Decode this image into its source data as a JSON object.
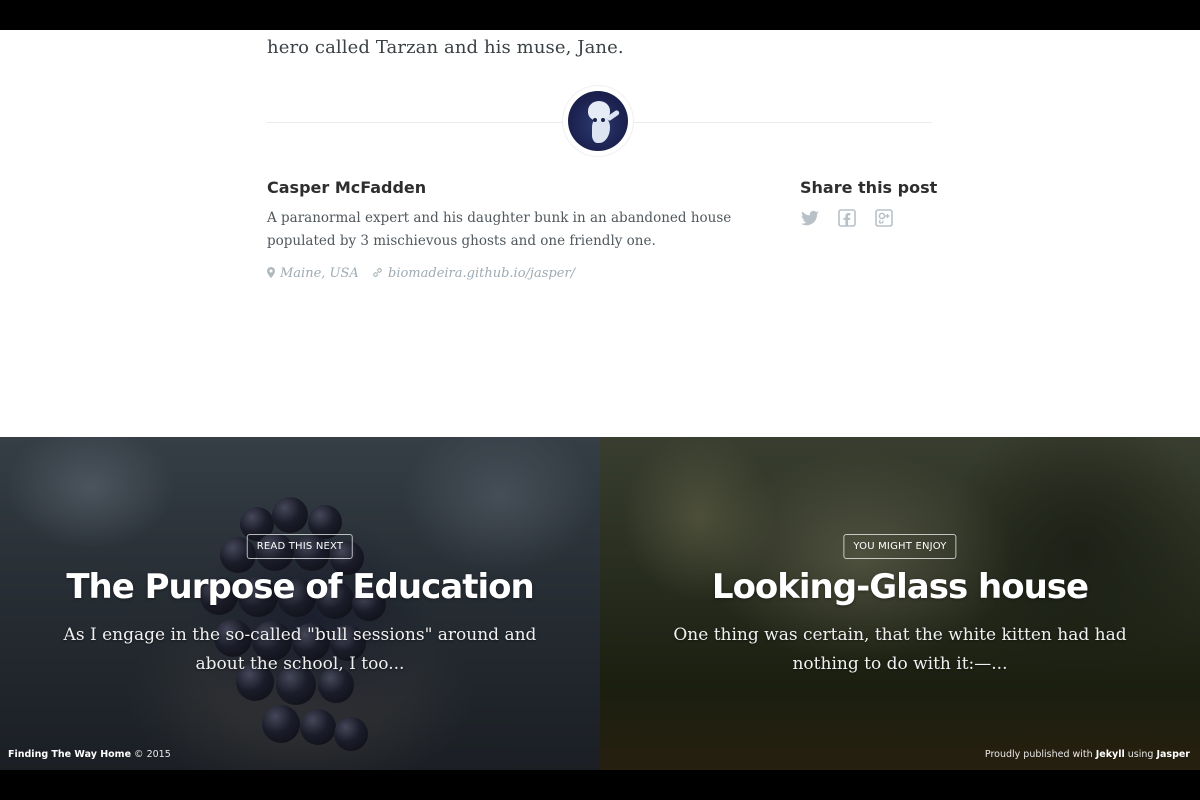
{
  "article": {
    "closing_text": "hero called Tarzan and his muse, Jane."
  },
  "author": {
    "avatar_icon": "ghost-avatar",
    "name": "Casper McFadden",
    "bio": "A paranormal expert and his daughter bunk in an abandoned house populated by 3 mischievous ghosts and one friendly one.",
    "location": "Maine, USA",
    "website": "biomadeira.github.io/jasper/",
    "location_icon": "map-pin-icon",
    "website_icon": "link-icon"
  },
  "share": {
    "title": "Share this post",
    "icons": [
      "twitter-icon",
      "facebook-icon",
      "google-plus-icon"
    ]
  },
  "next_posts": [
    {
      "tag": "READ THIS NEXT",
      "title": "The Purpose of Education",
      "excerpt": "As I engage in the so-called \"bull sessions\" around and about the school, I too..."
    },
    {
      "tag": "YOU MIGHT ENJOY",
      "title": "Looking-Glass house",
      "excerpt": "One thing was certain, that the white kitten had had nothing to do with it:—..."
    }
  ],
  "footer": {
    "site_name": "Finding The Way Home",
    "copyright": "© 2015",
    "published_prefix": "Proudly published with",
    "jekyll": "Jekyll",
    "using": "using",
    "jasper": "Jasper"
  }
}
